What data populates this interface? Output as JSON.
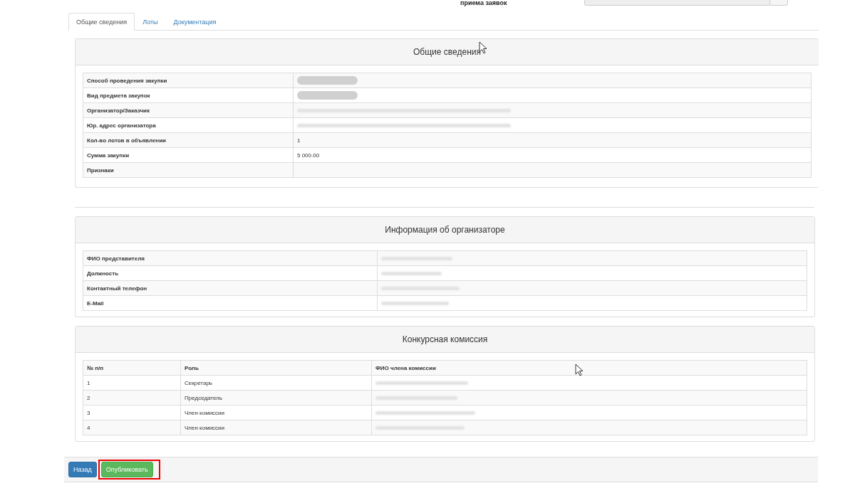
{
  "top_field": {
    "label": "приема заявок"
  },
  "tabs": [
    {
      "label": "Общие сведения",
      "selected": true
    },
    {
      "label": "Лоты",
      "selected": false
    },
    {
      "label": "Документация",
      "selected": false
    }
  ],
  "general": {
    "title": "Общие сведения",
    "rows": [
      {
        "label": "Способ проведения закупки",
        "kind": "blob"
      },
      {
        "label": "Вид предмета закупок",
        "kind": "blob"
      },
      {
        "label": "Организатор/Заказчик",
        "kind": "blur"
      },
      {
        "label": "Юр. адрес организатора",
        "kind": "blur"
      },
      {
        "label": "Кол-во лотов в объявлении",
        "kind": "text",
        "value": "1"
      },
      {
        "label": "Сумма закупки",
        "kind": "text",
        "value": "5 000.00"
      },
      {
        "label": "Признаки",
        "kind": "text"
      }
    ]
  },
  "organizer": {
    "title": "Информация об организаторе",
    "rows": [
      {
        "label": "ФИО представителя",
        "redacted": true
      },
      {
        "label": "Должность",
        "redacted": true
      },
      {
        "label": "Контактный телефон",
        "redacted": true
      },
      {
        "label": "E-Mail",
        "redacted": true
      }
    ]
  },
  "commission": {
    "title": "Конкурсная комиссия",
    "columns": [
      "№ п/п",
      "Роль",
      "ФИО члена комиссии"
    ],
    "rows": [
      {
        "number": "1",
        "role": "Секретарь",
        "redacted": true
      },
      {
        "number": "2",
        "role": "Председатель",
        "redacted": true
      },
      {
        "number": "3",
        "role": "Член комиссии",
        "redacted": true
      },
      {
        "number": "4",
        "role": "Член комиссии",
        "redacted": true
      }
    ]
  },
  "buttons": [
    {
      "label": "Назад",
      "kind": "primary",
      "highlighted": false
    },
    {
      "label": "Опубликовать",
      "kind": "success",
      "highlighted": true
    }
  ]
}
